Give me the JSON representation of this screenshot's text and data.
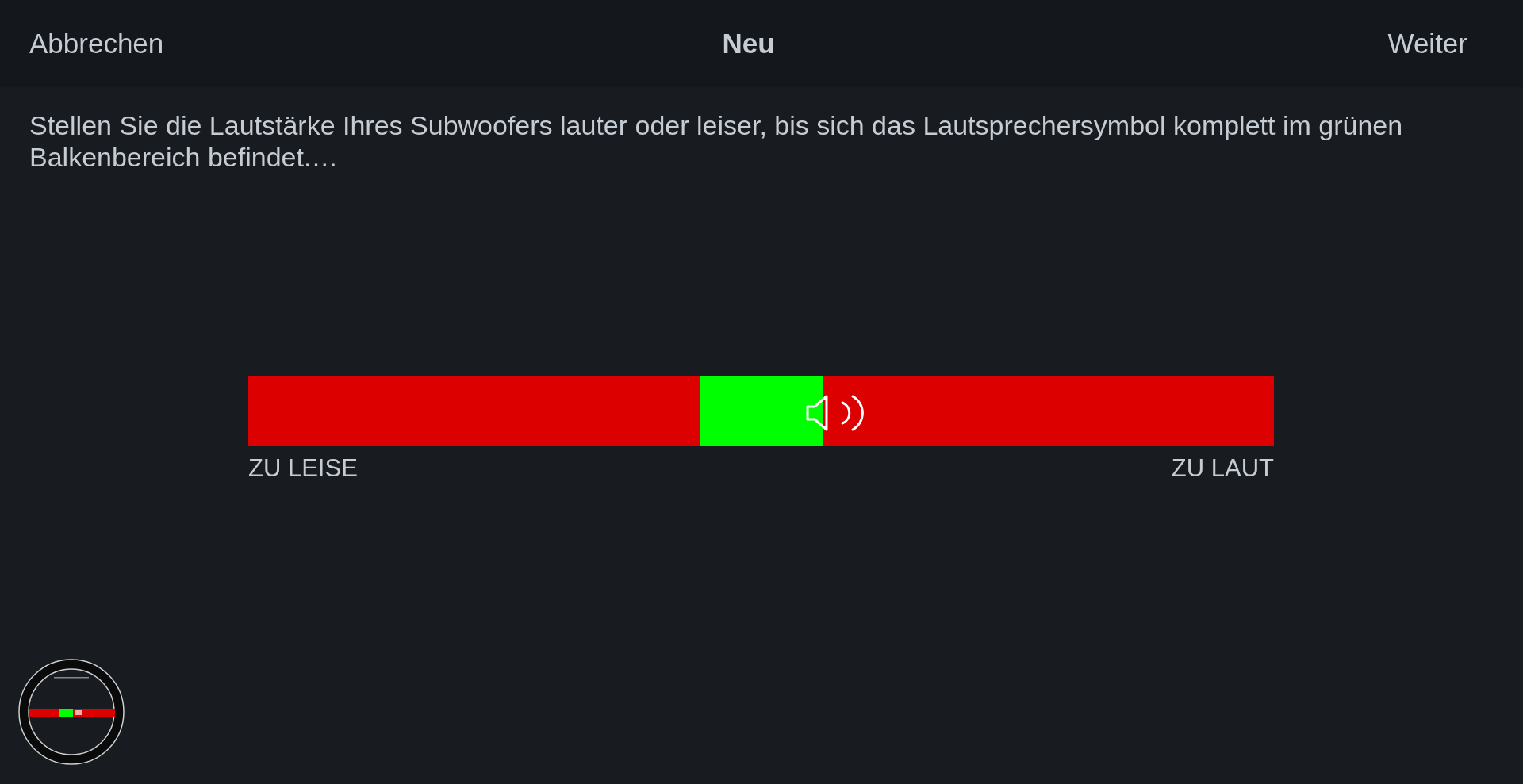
{
  "header": {
    "cancel": "Abbrechen",
    "title": "Neu",
    "next": "Weiter"
  },
  "instruction": "Stellen Sie die Lautstärke Ihres Subwoofers lauter oder leiser, bis sich das Lautsprechersymbol komplett im grünen Balkenbereich befindet.…",
  "meter": {
    "low_label": "ZU LEISE",
    "high_label": "ZU LAUT"
  }
}
